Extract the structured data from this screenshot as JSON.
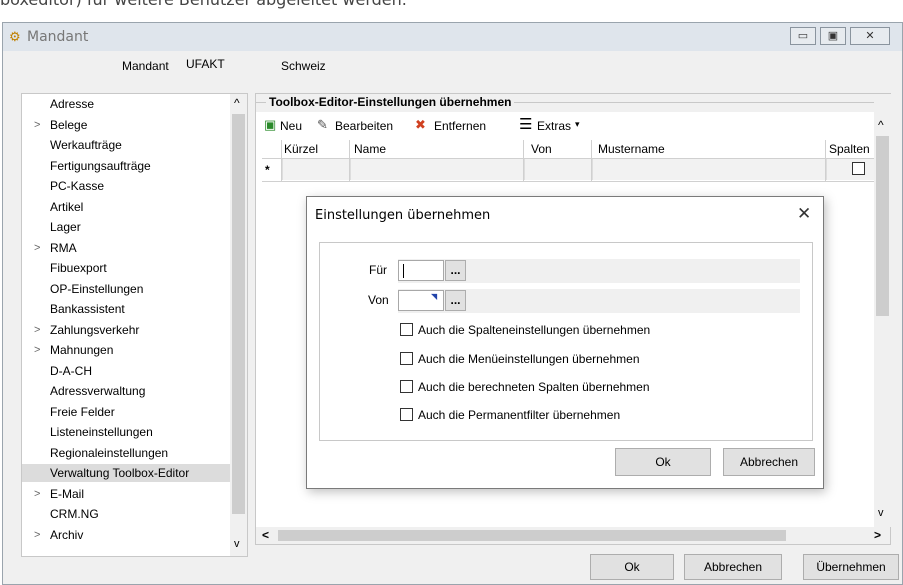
{
  "background_text": "boxeditor) für weitere Benutzer abgeleitet werden.",
  "window": {
    "title": "Mandant",
    "buttons": {
      "minimize": "▭",
      "maximize": "▣",
      "close": "✕"
    }
  },
  "mandant": {
    "label": "Mandant",
    "value": "UFAKT",
    "country": "Schweiz"
  },
  "tree": {
    "items": [
      {
        "label": "Adresse",
        "expand": ""
      },
      {
        "label": "Belege",
        "expand": ">"
      },
      {
        "label": "Werkaufträge",
        "expand": ""
      },
      {
        "label": "Fertigungsaufträge",
        "expand": ""
      },
      {
        "label": "PC-Kasse",
        "expand": ""
      },
      {
        "label": "Artikel",
        "expand": ""
      },
      {
        "label": "Lager",
        "expand": ""
      },
      {
        "label": "RMA",
        "expand": ">"
      },
      {
        "label": "Fibuexport",
        "expand": ""
      },
      {
        "label": "OP-Einstellungen",
        "expand": ""
      },
      {
        "label": "Bankassistent",
        "expand": ""
      },
      {
        "label": "Zahlungsverkehr",
        "expand": ">"
      },
      {
        "label": "Mahnungen",
        "expand": ">"
      },
      {
        "label": "D-A-CH",
        "expand": ""
      },
      {
        "label": "Adressverwaltung",
        "expand": ""
      },
      {
        "label": "Freie Felder",
        "expand": ""
      },
      {
        "label": "Listeneinstellungen",
        "expand": ""
      },
      {
        "label": "Regionaleinstellungen",
        "expand": ""
      },
      {
        "label": "Verwaltung Toolbox-Editor",
        "expand": "",
        "selected": true
      },
      {
        "label": "E-Mail",
        "expand": ">"
      },
      {
        "label": "CRM.NG",
        "expand": ""
      },
      {
        "label": "Archiv",
        "expand": ">"
      }
    ],
    "scroll_up": "^",
    "scroll_down": "v"
  },
  "section": {
    "title": "Toolbox-Editor-Einstellungen übernehmen",
    "toolbar": {
      "new": "Neu",
      "edit": "Bearbeiten",
      "remove": "Entfernen",
      "extras": "Extras",
      "extras_arrow": "▾"
    },
    "columns": [
      "Kürzel",
      "Name",
      "Von",
      "Mustername",
      "Spalten"
    ],
    "new_row_marker": "*",
    "scroll_up": "^",
    "scroll_down": "v",
    "scroll_left": "<",
    "scroll_right": ">"
  },
  "dialog": {
    "title": "Einstellungen übernehmen",
    "close": "✕",
    "fuer_label": "Für",
    "von_label": "Von",
    "browse": "...",
    "options": [
      "Auch die Spalteneinstellungen übernehmen",
      "Auch die Menüeinstellungen übernehmen",
      "Auch die berechneten Spalten übernehmen",
      "Auch die Permanentfilter übernehmen"
    ],
    "ok": "Ok",
    "cancel": "Abbrechen"
  },
  "footer": {
    "ok": "Ok",
    "cancel": "Abbrechen",
    "apply": "Übernehmen"
  }
}
